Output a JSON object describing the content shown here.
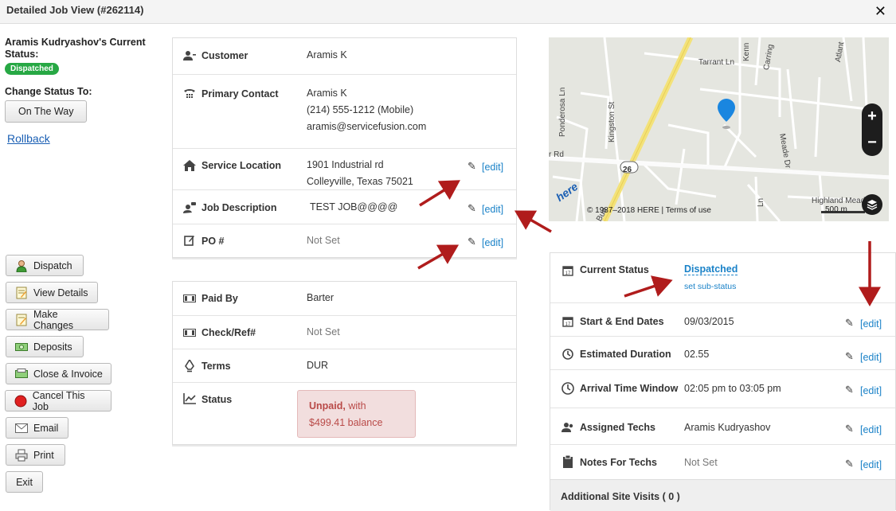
{
  "window": {
    "title": "Detailed Job View (#262114)",
    "close_glyph": "✕"
  },
  "status": {
    "heading": "Aramis Kudryashov's Current Status:",
    "badge": "Dispatched",
    "change_label": "Change Status To:",
    "next_button": "On The Way",
    "rollback": "Rollback"
  },
  "actions": [
    {
      "label": "Dispatch",
      "icon": "person-icon"
    },
    {
      "label": "View Details",
      "icon": "notepad-icon"
    },
    {
      "label": "Make Changes",
      "icon": "notepad-edit-icon"
    },
    {
      "label": "Deposits",
      "icon": "money-icon"
    },
    {
      "label": "Close & Invoice",
      "icon": "invoice-icon"
    },
    {
      "label": "Cancel This Job",
      "icon": "cancel-icon"
    },
    {
      "label": "Email",
      "icon": "envelope-icon"
    },
    {
      "label": "Print",
      "icon": "printer-icon"
    },
    {
      "label": "Exit",
      "icon": ""
    }
  ],
  "job_panel": {
    "customer_label": "Customer",
    "customer_value": "Aramis K",
    "contact_label": "Primary Contact",
    "contact_name": "Aramis K",
    "contact_phone": "(214) 555-1212 (Mobile)",
    "contact_email": "aramis@servicefusion.com",
    "location_label": "Service Location",
    "location_line1": "1901 Industrial rd",
    "location_line2": "Colleyville, Texas 75021",
    "description_label": "Job Description",
    "description_value": "TEST JOB@@@@",
    "po_label": "PO #",
    "po_value": "Not Set",
    "edit_label": "[edit]"
  },
  "billing_panel": {
    "paid_by_label": "Paid By",
    "paid_by_value": "Barter",
    "check_label": "Check/Ref#",
    "check_value": "Not Set",
    "terms_label": "Terms",
    "terms_value": "DUR",
    "status_label": "Status",
    "status_unpaid": "Unpaid,",
    "status_with": " with",
    "status_balance": "$499.41 balance"
  },
  "map": {
    "copyright": "© 1987–2018 HERE | Terms of use",
    "scale": "500 m",
    "logo": "here",
    "streets": {
      "tarrant": "Tarrant Ln",
      "ponderosa": "Ponderosa Ln",
      "kingston": "Kingston St",
      "meade": "Meade Dr",
      "highland": "Highland Meadow",
      "rd": "r Rd",
      "route": "26",
      "carring": "Carring",
      "kenn": "Kenn",
      "atlant": "Atlant",
      "bud": "Bud",
      "ln": "Ln"
    }
  },
  "schedule_panel": {
    "current_status_label": "Current Status",
    "current_status_value": "Dispatched",
    "sub_status": "set sub-status",
    "dates_label": "Start & End Dates",
    "dates_value": "09/03/2015",
    "duration_label": "Estimated Duration",
    "duration_value": "02.55",
    "arrival_label": "Arrival Time Window",
    "arrival_value": "02:05 pm to 03:05 pm",
    "techs_label": "Assigned Techs",
    "techs_value": "Aramis Kudryashov",
    "notes_label": "Notes For Techs",
    "notes_value": "Not Set",
    "additional_visits": "Additional Site Visits ( 0 )",
    "edit_label": "[edit]"
  },
  "colors": {
    "link": "#1a82c8",
    "badge": "#27a844",
    "unpaid_bg": "#f2dede",
    "unpaid_text": "#b94a48",
    "arrow": "#b01c1c"
  }
}
